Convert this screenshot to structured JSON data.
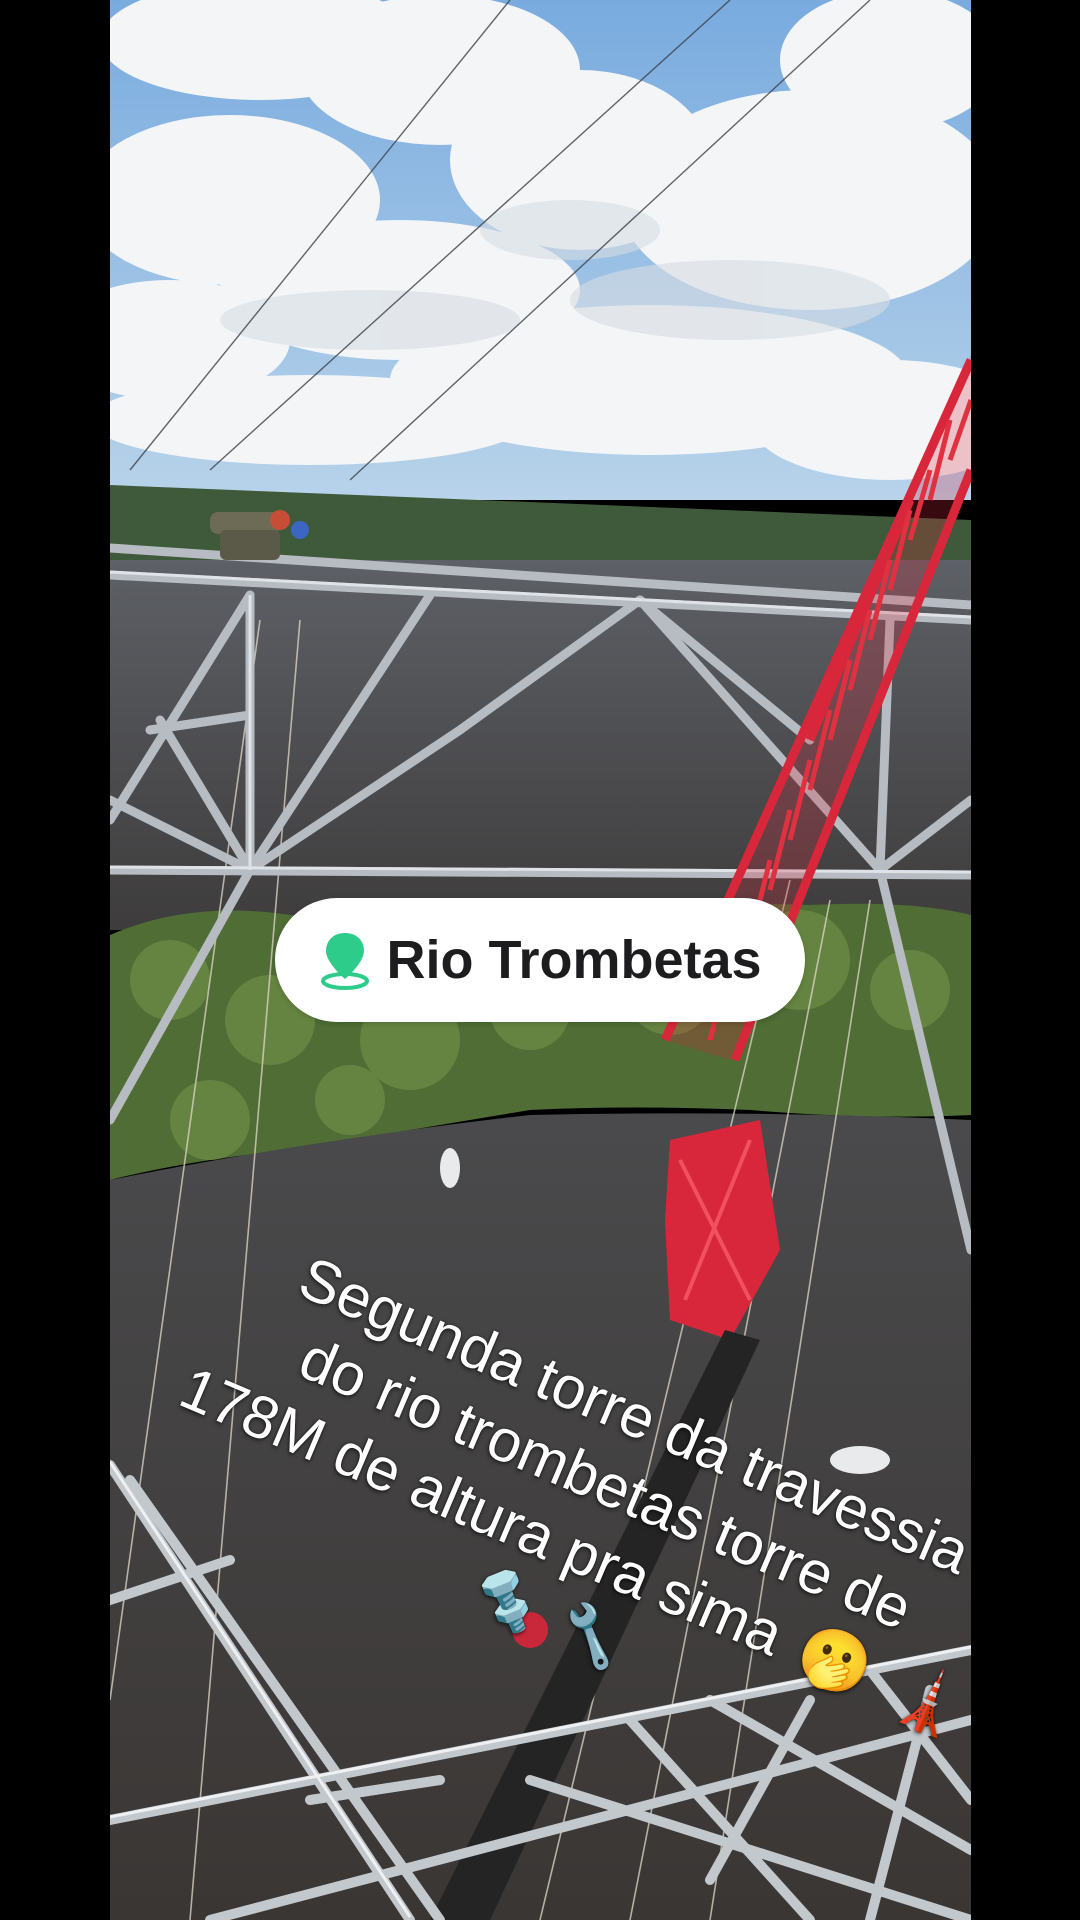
{
  "location_sticker": {
    "label": "Rio Trombetas",
    "icon": "map-pin-icon",
    "icon_color": "#2ecc8a"
  },
  "caption": {
    "lines": [
      "Segunda torre da travessia",
      "do rio trombetas torre de",
      "178M de altura pra sima"
    ],
    "emojis": {
      "after_text": "🫢",
      "tower": "🗼",
      "bolt": "🔩",
      "wrench": "🔧"
    }
  },
  "scene": {
    "sky_color": "#8fbde6",
    "cloud_color": "#f4f6f8",
    "river_color": "#4c4e52",
    "forest_color": "#4e6b34",
    "crane_color": "#d8273a",
    "tower_steel_color": "#b9bec4"
  }
}
